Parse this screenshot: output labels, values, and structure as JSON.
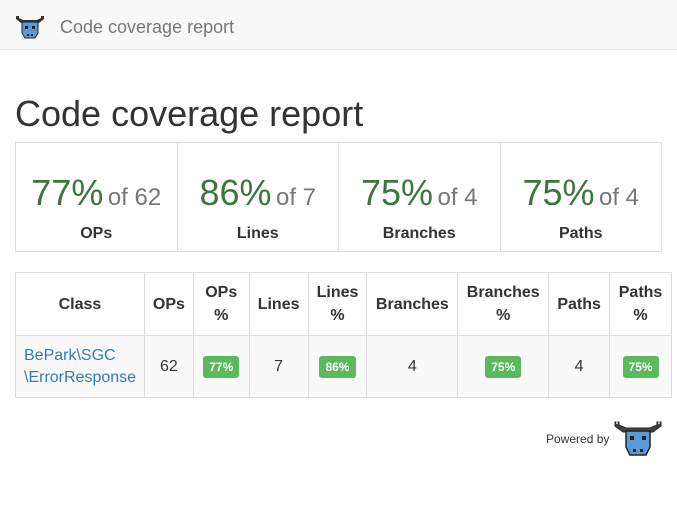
{
  "navbar": {
    "brand": "Code coverage report",
    "logo_icon": "infection-bull-logo"
  },
  "page_title": "Code coverage report",
  "colors": {
    "success_text": "#3c763d",
    "badge_success": "#5cb85c",
    "link": "#337ab7"
  },
  "summary": [
    {
      "percent": "77%",
      "of_text": "of 62",
      "label": "OPs"
    },
    {
      "percent": "86%",
      "of_text": "of 7",
      "label": "Lines"
    },
    {
      "percent": "75%",
      "of_text": "of 4",
      "label": "Branches"
    },
    {
      "percent": "75%",
      "of_text": "of 4",
      "label": "Paths"
    }
  ],
  "table": {
    "headers": {
      "class": "Class",
      "ops": "OPs",
      "ops_pct_1": "OPs",
      "ops_pct_2": "%",
      "lines": "Lines",
      "lines_pct_1": "Lines",
      "lines_pct_2": "%",
      "branches": "Branches",
      "branches_pct_1": "Branches",
      "branches_pct_2": "%",
      "paths": "Paths",
      "paths_pct_1": "Paths",
      "paths_pct_2": "%"
    },
    "rows": [
      {
        "class_line1": "BePark\\SGC",
        "class_line2": "\\ErrorResponse",
        "ops": "62",
        "ops_pct": "77%",
        "lines": "7",
        "lines_pct": "86%",
        "branches": "4",
        "branches_pct": "75%",
        "paths": "4",
        "paths_pct": "75%"
      }
    ]
  },
  "footer": {
    "powered_by": "Powered by",
    "logo_icon": "infection-bull-logo"
  }
}
